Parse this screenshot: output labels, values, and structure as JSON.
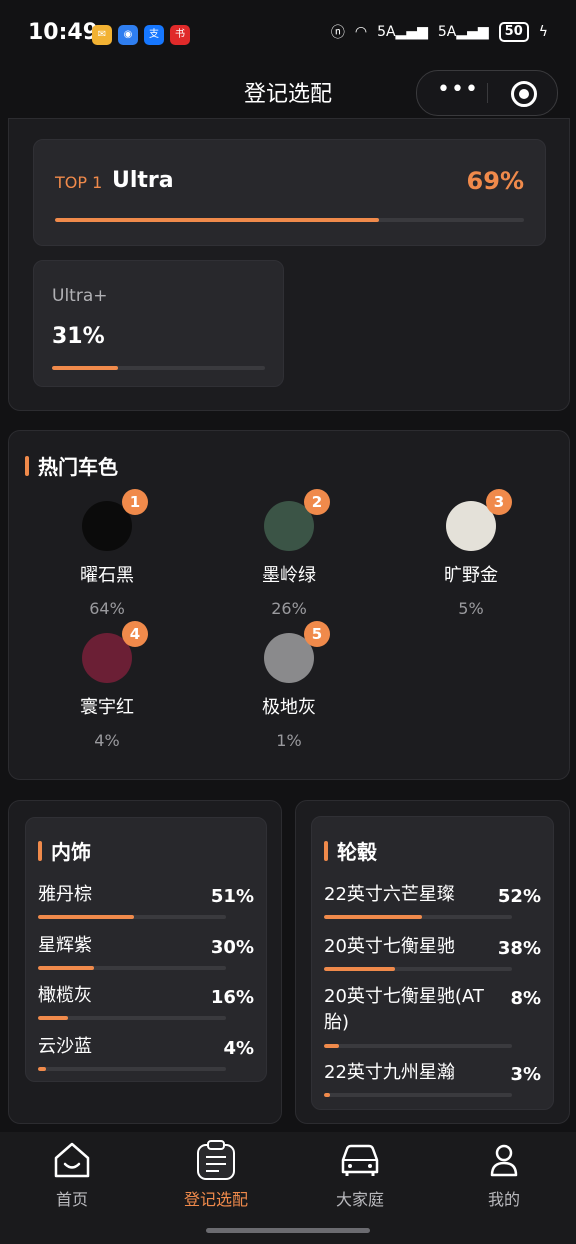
{
  "status": {
    "time": "10:49",
    "signal1": "5A",
    "signal2": "5A",
    "battery": "50"
  },
  "header": {
    "title": "登记选配"
  },
  "trims": {
    "top": {
      "rank_label": "TOP 1",
      "name": "Ultra",
      "percent": "69%",
      "fraction": 0.69
    },
    "second": {
      "name": "Ultra+",
      "percent": "31%",
      "fraction": 0.31
    }
  },
  "colors": {
    "title": "热门车色",
    "items": [
      {
        "rank": "1",
        "name": "曜石黑",
        "percent": "64%",
        "hex": "#0b0b0b"
      },
      {
        "rank": "2",
        "name": "墨岭绿",
        "percent": "26%",
        "hex": "#3b5446"
      },
      {
        "rank": "3",
        "name": "旷野金",
        "percent": "5%",
        "hex": "#e4e1d9"
      },
      {
        "rank": "4",
        "name": "寰宇红",
        "percent": "4%",
        "hex": "#6b1f35"
      },
      {
        "rank": "5",
        "name": "极地灰",
        "percent": "1%",
        "hex": "#8a8a8c"
      }
    ]
  },
  "interior": {
    "title": "内饰",
    "items": [
      {
        "name": "雅丹棕",
        "percent": "51%",
        "fraction": 0.51
      },
      {
        "name": "星辉紫",
        "percent": "30%",
        "fraction": 0.3
      },
      {
        "name": "橄榄灰",
        "percent": "16%",
        "fraction": 0.16
      },
      {
        "name": "云沙蓝",
        "percent": "4%",
        "fraction": 0.04
      }
    ]
  },
  "wheels": {
    "title": "轮毂",
    "items": [
      {
        "name": "22英寸六芒星璨",
        "percent": "52%",
        "fraction": 0.52
      },
      {
        "name": "20英寸七衡星驰",
        "percent": "38%",
        "fraction": 0.38
      },
      {
        "name": "20英寸七衡星驰(AT胎)",
        "percent": "8%",
        "fraction": 0.08
      },
      {
        "name": "22英寸九州星瀚",
        "percent": "3%",
        "fraction": 0.03
      }
    ]
  },
  "tabs": [
    {
      "label": "首页",
      "icon": "home-icon"
    },
    {
      "label": "登记选配",
      "icon": "clipboard-icon",
      "active": true
    },
    {
      "label": "大家庭",
      "icon": "car-icon"
    },
    {
      "label": "我的",
      "icon": "person-icon"
    }
  ],
  "theme": {
    "accent": "#f08a4b",
    "background": "#121214"
  }
}
